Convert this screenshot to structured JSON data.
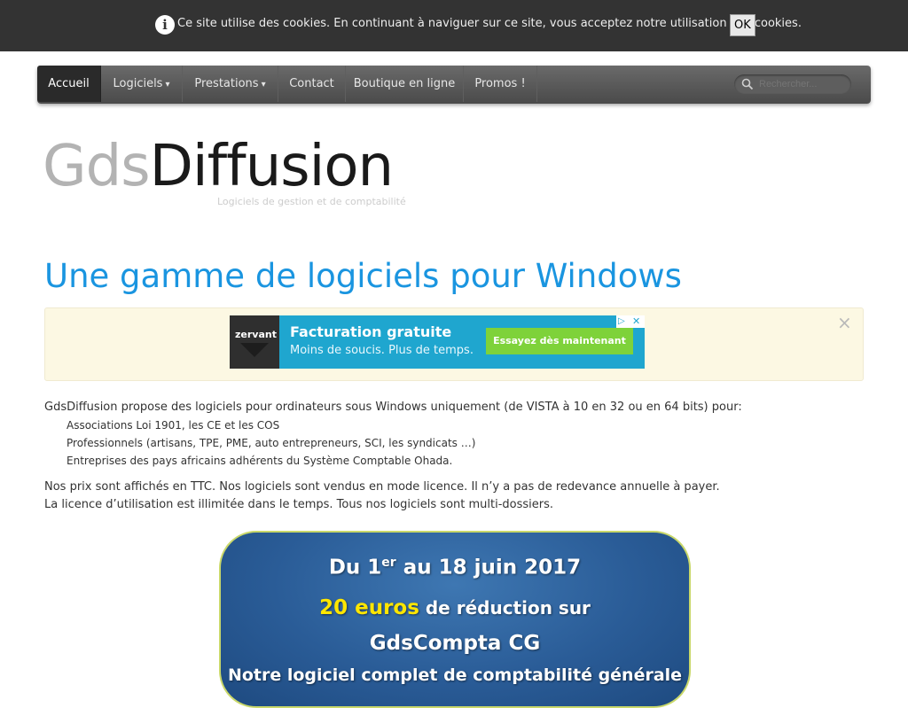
{
  "cookie_bar": {
    "message": "Ce site utilise des cookies. En continuant à naviguer sur ce site, vous acceptez notre utilisation des cookies.",
    "ok_label": "OK"
  },
  "nav": {
    "items": [
      {
        "label": "Accueil",
        "active": true
      },
      {
        "label": "Logiciels",
        "dropdown": true
      },
      {
        "label": "Prestations",
        "dropdown": true
      },
      {
        "label": "Contact"
      },
      {
        "label": "Boutique en ligne"
      },
      {
        "label": "Promos !"
      }
    ],
    "dropdown_caret": "▾",
    "search_placeholder": "Rechercher..."
  },
  "branding": {
    "logo_light": "Gds",
    "logo_dark": "Diffusion",
    "tagline": "Logiciels de gestion et de comptabilité"
  },
  "page_title": "Une gamme de logiciels pour Windows",
  "ad": {
    "brand": "zervant",
    "title": "Facturation gratuite",
    "subtitle": "Moins de soucis. Plus de temps.",
    "cta": "Essayez dès maintenant",
    "close_glyph": "×"
  },
  "content": {
    "intro": "GdsDiffusion propose des logiciels pour ordinateurs sous Windows uniquement (de VISTA à 10 en 32 ou en 64 bits) pour:",
    "bullets": [
      "Associations Loi 1901, les CE et les COS",
      "Professionnels (artisans, TPE, PME, auto entrepreneurs, SCI, les syndicats …)",
      "Entreprises des pays africains adhérents du Système Comptable Ohada."
    ],
    "paragraph_lines": [
      "Nos prix sont affichés en TTC. Nos logiciels sont vendus en mode licence.  Il n’y a pas de redevance annuelle à payer.",
      "La licence d’utilisation est illimitée dans le temps. Tous nos logiciels sont multi-dossiers."
    ]
  },
  "promo": {
    "date_prefix": "Du 1",
    "date_sup": "er",
    "date_suffix": " au 18 juin 2017",
    "amount": "20 euros",
    "reduction_text": " de réduction sur",
    "product": "GdsCompta CG",
    "description": "Notre logiciel complet de comptabilité générale"
  },
  "colors": {
    "cookie_bar_bg": "#333333",
    "nav_bg": "#555555",
    "title_blue": "#1a95e0",
    "ad_box_bg": "#fcf8e3",
    "promo_blue": "#2a5c97",
    "promo_yellow": "#ffe600"
  }
}
